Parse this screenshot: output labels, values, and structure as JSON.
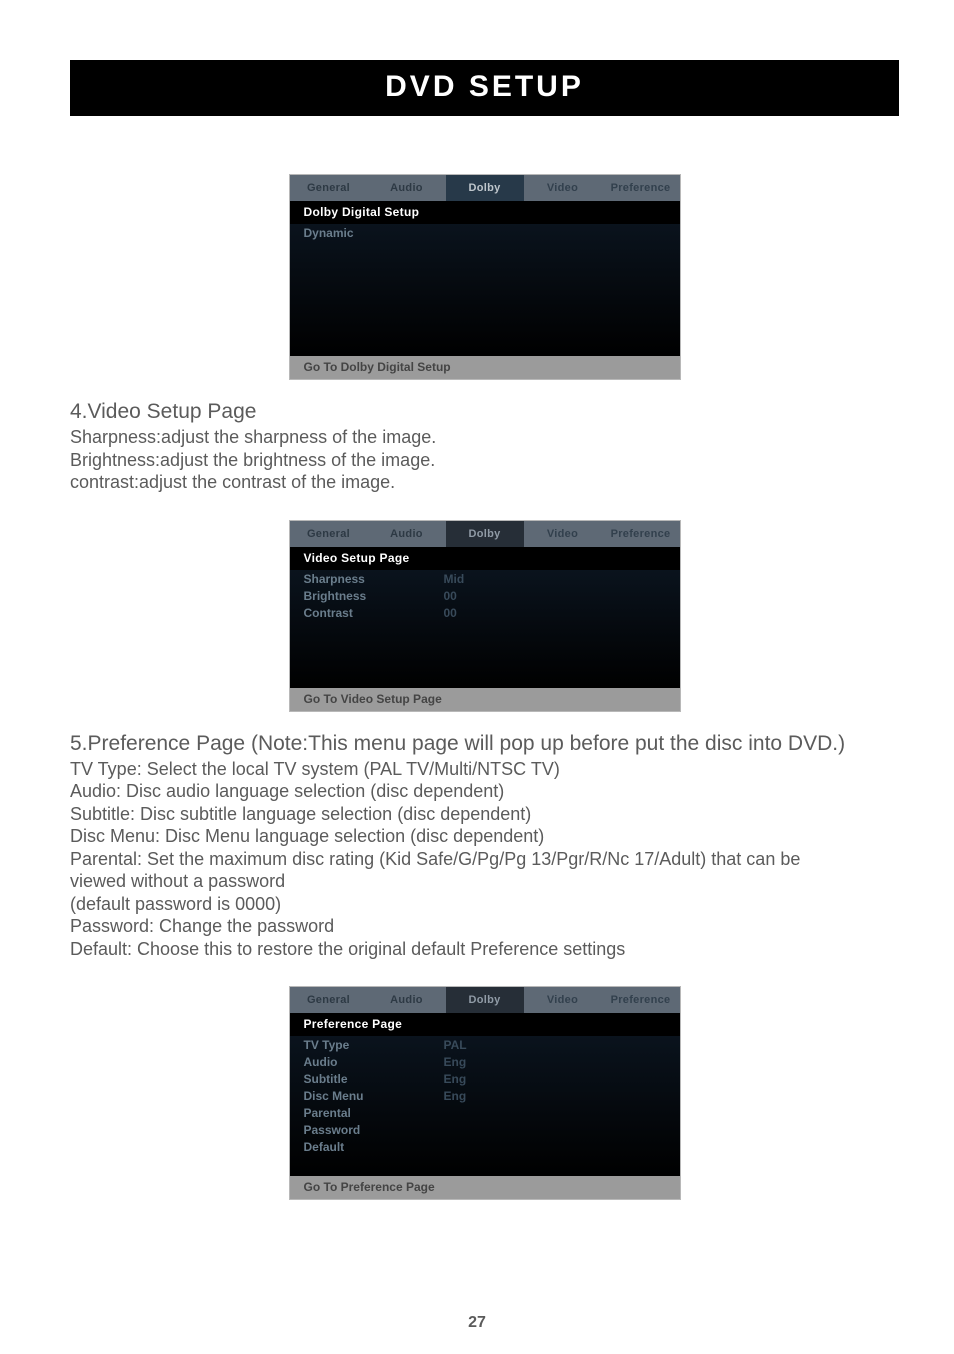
{
  "title": "DVD  SETUP",
  "pageNumber": "27",
  "osd1": {
    "tabs": [
      "General",
      "Audio",
      "Dolby",
      "Video",
      "Preference"
    ],
    "heading": "Dolby  Digital  Setup",
    "rows": [
      {
        "label": "Dynamic",
        "value": ""
      }
    ],
    "footer": "Go  To  Dolby  Digital  Setup"
  },
  "section4": {
    "heading": "4.Video Setup Page",
    "lines": [
      "Sharpness:adjust the sharpness of the image.",
      "Brightness:adjust the brightness of the image.",
      "contrast:adjust the contrast of the image."
    ]
  },
  "osd2": {
    "tabs": [
      "General",
      "Audio",
      "Dolby",
      "Video",
      "Preference"
    ],
    "heading": "Video  Setup  Page",
    "rows": [
      {
        "label": "Sharpness",
        "value": "Mid"
      },
      {
        "label": "Brightness",
        "value": "00"
      },
      {
        "label": "Contrast",
        "value": "00"
      }
    ],
    "footer": "Go  To  Video  Setup  Page"
  },
  "section5": {
    "heading": "5.Preference Page (Note:This menu page will pop up before put the disc into DVD.)",
    "lines": [
      "TV Type: Select the local TV system (PAL TV/Multi/NTSC TV)",
      "Audio: Disc audio language selection (disc dependent)",
      "Subtitle: Disc subtitle language selection (disc dependent)",
      "Disc Menu: Disc Menu language selection (disc dependent)",
      "Parental: Set the maximum disc rating (Kid Safe/G/Pg/Pg 13/Pgr/R/Nc 17/Adult) that can be",
      " viewed without a password",
      "(default password is 0000)",
      "Password: Change the password",
      "Default: Choose this to restore the original default Preference settings"
    ]
  },
  "osd3": {
    "tabs": [
      "General",
      "Audio",
      "Dolby",
      "Video",
      "Preference"
    ],
    "heading": "Preference  Page",
    "rows": [
      {
        "label": "TV  Type",
        "value": "PAL"
      },
      {
        "label": "Audio",
        "value": "Eng"
      },
      {
        "label": "Subtitle",
        "value": "Eng"
      },
      {
        "label": "Disc  Menu",
        "value": "Eng"
      },
      {
        "label": "Parental",
        "value": ""
      },
      {
        "label": "Password",
        "value": ""
      },
      {
        "label": "Default",
        "value": ""
      }
    ],
    "footer": "Go  To  Preference  Page"
  }
}
